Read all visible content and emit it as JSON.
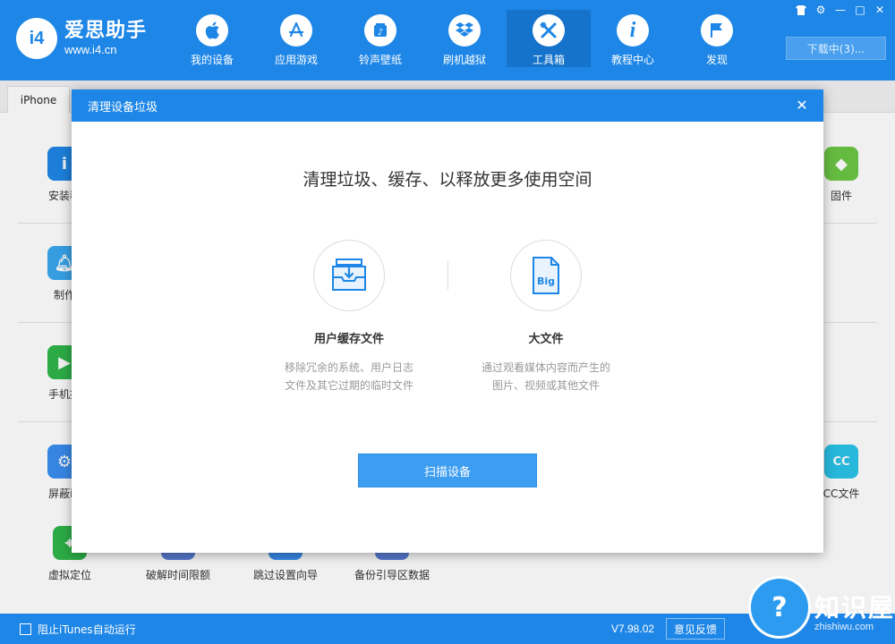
{
  "app": {
    "name": "爱思助手",
    "url": "www.i4.cn",
    "logo_mark": "i4"
  },
  "nav": [
    {
      "label": "我的设备",
      "icon": "apple-icon",
      "glyph": ""
    },
    {
      "label": "应用游戏",
      "icon": "app-store-icon",
      "glyph": "A"
    },
    {
      "label": "铃声壁纸",
      "icon": "music-icon",
      "glyph": "♫"
    },
    {
      "label": "刷机越狱",
      "icon": "dropbox-icon",
      "glyph": "❖"
    },
    {
      "label": "工具箱",
      "icon": "tools-icon",
      "glyph": "✕"
    },
    {
      "label": "教程中心",
      "icon": "info-icon",
      "glyph": "i"
    },
    {
      "label": "发现",
      "icon": "flag-icon",
      "glyph": "⚑"
    }
  ],
  "window_controls": [
    "👕",
    "⚙",
    "—",
    "□",
    "✕"
  ],
  "download_label": "下载中(3)...",
  "device_tab": "iPhone",
  "tools": {
    "row1_left": "安装移",
    "row1_right": "固件",
    "row2_left": "制作",
    "row3_left": "手机投",
    "row4_left": "屏蔽iC",
    "row4_right": "CC文件",
    "row5": [
      "虚拟定位",
      "破解时间限额",
      "跳过设置向导",
      "备份引导区数据"
    ]
  },
  "modal": {
    "header": "清理设备垃圾",
    "close": "✕",
    "title": "清理垃圾、缓存、以释放更多使用空间",
    "options": [
      {
        "title": "用户缓存文件",
        "desc1": "移除冗余的系统、用户日志",
        "desc2": "文件及其它过期的临时文件",
        "icon_text": ""
      },
      {
        "title": "大文件",
        "desc1": "通过观看媒体内容而产生的",
        "desc2": "图片、视频或其他文件",
        "icon_text": "Big"
      }
    ],
    "scan_button": "扫描设备"
  },
  "bottom": {
    "itunes_label": "阻止iTunes自动运行",
    "version": "V7.98.02",
    "feedback": "意见反馈"
  },
  "watermark": {
    "name": "知识屋",
    "url": "zhishiwu.com",
    "glyph": "?"
  },
  "colors": {
    "primary": "#1e86e6",
    "button": "#3d9df1"
  }
}
